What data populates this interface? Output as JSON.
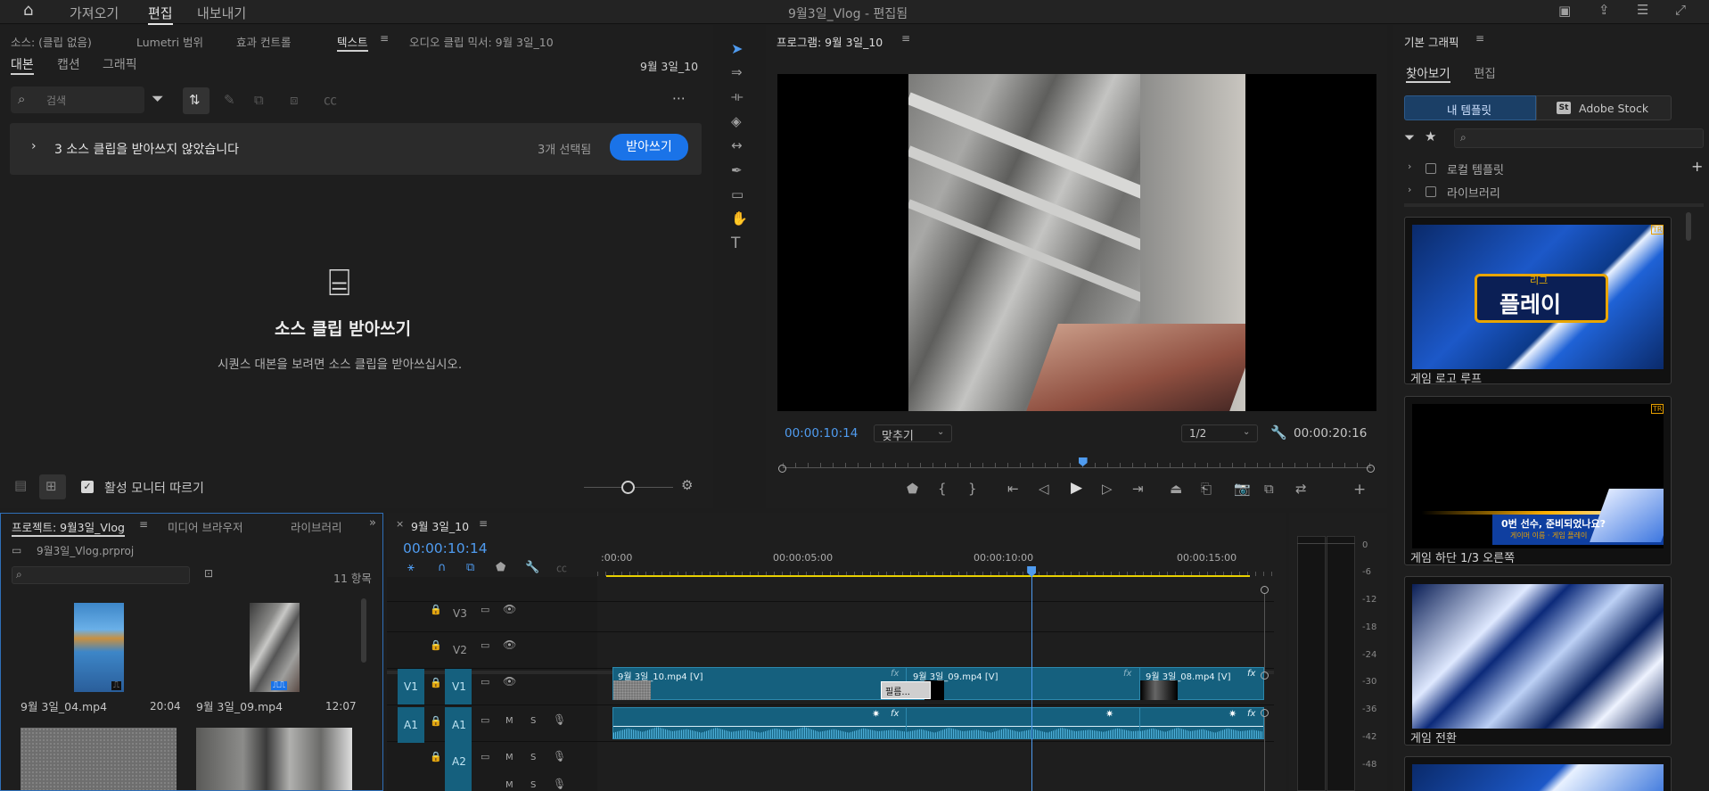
{
  "header": {
    "workspaces": [
      "가져오기",
      "편집",
      "내보내기"
    ],
    "active_workspace": "편집",
    "title": "9월3일_Vlog - 편집됨"
  },
  "source_panel": {
    "tabs": [
      "소스: (클립 없음)",
      "Lumetri 범위",
      "효과 컨트롤",
      "텍스트",
      "오디오 클립 믹서: 9월 3일_10"
    ],
    "active_tab": "텍스트",
    "sub_tabs": [
      "대본",
      "캡션",
      "그래픽"
    ],
    "sequence_name": "9월 3일_10",
    "search_placeholder": "검색",
    "banner_text": "3 소스 클립을 받아쓰지 않았습니다",
    "selected_count": "3개 선택됨",
    "transcribe_button": "받아쓰기",
    "empty_title": "소스 클립 받아쓰기",
    "empty_desc": "시퀀스 대본을 보려면 소스 클립을 받아쓰십시오.",
    "follow_monitor": "활성 모니터 따르기"
  },
  "program_monitor": {
    "title": "프로그램: 9월 3일_10",
    "timecode": "00:00:10:14",
    "fit": "맞추기",
    "resolution": "1/2",
    "duration": "00:00:20:16",
    "playhead_fraction": 0.51
  },
  "essential_graphics": {
    "title": "기본 그래픽",
    "tabs": [
      "찾아보기",
      "편집"
    ],
    "source_tabs": [
      "내 템플릿",
      "Adobe Stock"
    ],
    "stock_badge": "St",
    "folders": [
      "로컬 템플릿",
      "라이브러리"
    ],
    "templates": [
      {
        "name": "게임 로고 루프",
        "badge": "TR",
        "line1": "리그",
        "line2": "플레이"
      },
      {
        "name": "게임 하단 1/3 오른쪽",
        "badge": "TR",
        "line1": "0번 선수, 준비되었나요?",
        "line2": "게이머 이름 · 게임 플레이"
      },
      {
        "name": "게임 전환",
        "badge": "",
        "line1": "",
        "line2": ""
      }
    ]
  },
  "project_panel": {
    "tabs": [
      "프로젝트: 9월3일_Vlog",
      "미디어 브라우저",
      "라이브러리"
    ],
    "file": "9월3일_Vlog.prproj",
    "item_count": "11 항목",
    "items": [
      {
        "name": "9월 3일_04.mp4",
        "duration": "20:04"
      },
      {
        "name": "9월 3일_09.mp4",
        "duration": "12:07"
      },
      {
        "name": "",
        "duration": ""
      },
      {
        "name": "",
        "duration": ""
      }
    ]
  },
  "timeline": {
    "title": "9월 3일_10",
    "timecode": "00:00:10:14",
    "ruler": [
      ":00:00",
      "00:00:05:00",
      "00:00:10:00",
      "00:00:15:00"
    ],
    "tracks": [
      "V3",
      "V2",
      "V1",
      "A1",
      "A2"
    ],
    "source_patch": {
      "video": "V1",
      "audio": "A1"
    },
    "track_buttons": {
      "mute": "M",
      "solo": "S"
    },
    "clips": [
      "9월 3일_10.mp4 [V]",
      "9월 3일_09.mp4 [V]",
      "9월 3일_08.mp4 [V]"
    ],
    "transition_label": "필름...",
    "fx": "fx",
    "playhead_seconds": 10.58
  },
  "audio_meter": {
    "scale": [
      "0",
      "-6",
      "-12",
      "-18",
      "-24",
      "-30",
      "-36",
      "-42",
      "-48"
    ]
  }
}
